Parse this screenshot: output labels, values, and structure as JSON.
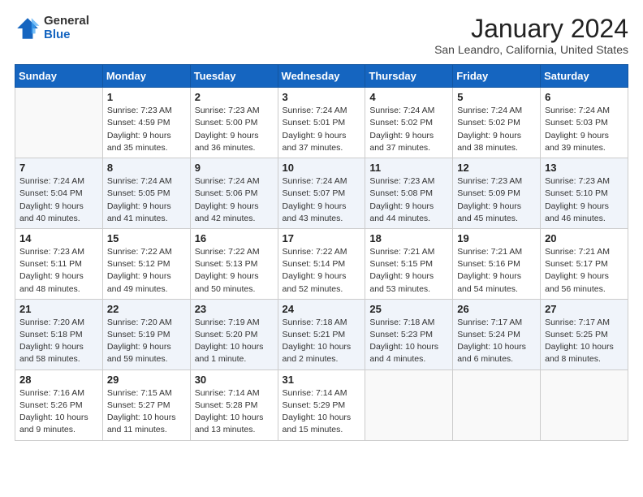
{
  "logo": {
    "general": "General",
    "blue": "Blue"
  },
  "title": "January 2024",
  "subtitle": "San Leandro, California, United States",
  "weekdays": [
    "Sunday",
    "Monday",
    "Tuesday",
    "Wednesday",
    "Thursday",
    "Friday",
    "Saturday"
  ],
  "weeks": [
    [
      {
        "day": "",
        "info": ""
      },
      {
        "day": "1",
        "info": "Sunrise: 7:23 AM\nSunset: 4:59 PM\nDaylight: 9 hours\nand 35 minutes."
      },
      {
        "day": "2",
        "info": "Sunrise: 7:23 AM\nSunset: 5:00 PM\nDaylight: 9 hours\nand 36 minutes."
      },
      {
        "day": "3",
        "info": "Sunrise: 7:24 AM\nSunset: 5:01 PM\nDaylight: 9 hours\nand 37 minutes."
      },
      {
        "day": "4",
        "info": "Sunrise: 7:24 AM\nSunset: 5:02 PM\nDaylight: 9 hours\nand 37 minutes."
      },
      {
        "day": "5",
        "info": "Sunrise: 7:24 AM\nSunset: 5:02 PM\nDaylight: 9 hours\nand 38 minutes."
      },
      {
        "day": "6",
        "info": "Sunrise: 7:24 AM\nSunset: 5:03 PM\nDaylight: 9 hours\nand 39 minutes."
      }
    ],
    [
      {
        "day": "7",
        "info": "Sunrise: 7:24 AM\nSunset: 5:04 PM\nDaylight: 9 hours\nand 40 minutes."
      },
      {
        "day": "8",
        "info": "Sunrise: 7:24 AM\nSunset: 5:05 PM\nDaylight: 9 hours\nand 41 minutes."
      },
      {
        "day": "9",
        "info": "Sunrise: 7:24 AM\nSunset: 5:06 PM\nDaylight: 9 hours\nand 42 minutes."
      },
      {
        "day": "10",
        "info": "Sunrise: 7:24 AM\nSunset: 5:07 PM\nDaylight: 9 hours\nand 43 minutes."
      },
      {
        "day": "11",
        "info": "Sunrise: 7:23 AM\nSunset: 5:08 PM\nDaylight: 9 hours\nand 44 minutes."
      },
      {
        "day": "12",
        "info": "Sunrise: 7:23 AM\nSunset: 5:09 PM\nDaylight: 9 hours\nand 45 minutes."
      },
      {
        "day": "13",
        "info": "Sunrise: 7:23 AM\nSunset: 5:10 PM\nDaylight: 9 hours\nand 46 minutes."
      }
    ],
    [
      {
        "day": "14",
        "info": "Sunrise: 7:23 AM\nSunset: 5:11 PM\nDaylight: 9 hours\nand 48 minutes."
      },
      {
        "day": "15",
        "info": "Sunrise: 7:22 AM\nSunset: 5:12 PM\nDaylight: 9 hours\nand 49 minutes."
      },
      {
        "day": "16",
        "info": "Sunrise: 7:22 AM\nSunset: 5:13 PM\nDaylight: 9 hours\nand 50 minutes."
      },
      {
        "day": "17",
        "info": "Sunrise: 7:22 AM\nSunset: 5:14 PM\nDaylight: 9 hours\nand 52 minutes."
      },
      {
        "day": "18",
        "info": "Sunrise: 7:21 AM\nSunset: 5:15 PM\nDaylight: 9 hours\nand 53 minutes."
      },
      {
        "day": "19",
        "info": "Sunrise: 7:21 AM\nSunset: 5:16 PM\nDaylight: 9 hours\nand 54 minutes."
      },
      {
        "day": "20",
        "info": "Sunrise: 7:21 AM\nSunset: 5:17 PM\nDaylight: 9 hours\nand 56 minutes."
      }
    ],
    [
      {
        "day": "21",
        "info": "Sunrise: 7:20 AM\nSunset: 5:18 PM\nDaylight: 9 hours\nand 58 minutes."
      },
      {
        "day": "22",
        "info": "Sunrise: 7:20 AM\nSunset: 5:19 PM\nDaylight: 9 hours\nand 59 minutes."
      },
      {
        "day": "23",
        "info": "Sunrise: 7:19 AM\nSunset: 5:20 PM\nDaylight: 10 hours\nand 1 minute."
      },
      {
        "day": "24",
        "info": "Sunrise: 7:18 AM\nSunset: 5:21 PM\nDaylight: 10 hours\nand 2 minutes."
      },
      {
        "day": "25",
        "info": "Sunrise: 7:18 AM\nSunset: 5:23 PM\nDaylight: 10 hours\nand 4 minutes."
      },
      {
        "day": "26",
        "info": "Sunrise: 7:17 AM\nSunset: 5:24 PM\nDaylight: 10 hours\nand 6 minutes."
      },
      {
        "day": "27",
        "info": "Sunrise: 7:17 AM\nSunset: 5:25 PM\nDaylight: 10 hours\nand 8 minutes."
      }
    ],
    [
      {
        "day": "28",
        "info": "Sunrise: 7:16 AM\nSunset: 5:26 PM\nDaylight: 10 hours\nand 9 minutes."
      },
      {
        "day": "29",
        "info": "Sunrise: 7:15 AM\nSunset: 5:27 PM\nDaylight: 10 hours\nand 11 minutes."
      },
      {
        "day": "30",
        "info": "Sunrise: 7:14 AM\nSunset: 5:28 PM\nDaylight: 10 hours\nand 13 minutes."
      },
      {
        "day": "31",
        "info": "Sunrise: 7:14 AM\nSunset: 5:29 PM\nDaylight: 10 hours\nand 15 minutes."
      },
      {
        "day": "",
        "info": ""
      },
      {
        "day": "",
        "info": ""
      },
      {
        "day": "",
        "info": ""
      }
    ]
  ]
}
